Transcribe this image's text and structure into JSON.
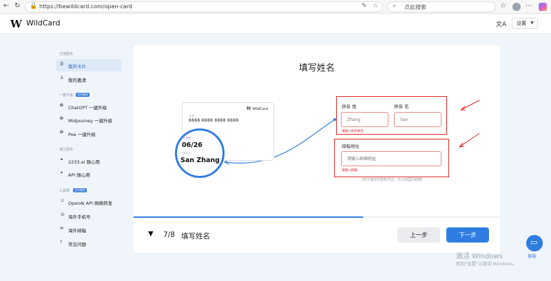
{
  "browser": {
    "url": "https://bewildcard.com/open-card",
    "search_placeholder": "点此搜索"
  },
  "header": {
    "logo_mark": "W",
    "logo_text": "WildCard",
    "settings_label": "设置"
  },
  "sidebar": {
    "sections": [
      {
        "title": "已用服务",
        "badge": ""
      },
      {
        "title": "一键升级",
        "badge": "全托服务"
      },
      {
        "title": "独立服务",
        "badge": ""
      },
      {
        "title": "工具箱",
        "badge": "全托服务"
      }
    ],
    "items": [
      {
        "label": "我的卡片",
        "icon": "cards-icon",
        "active": true
      },
      {
        "label": "我的邀请",
        "icon": "users-icon",
        "active": false
      },
      {
        "label": "ChatGPT 一键升级",
        "icon": "openai-icon",
        "active": false
      },
      {
        "label": "Midjourney 一键升级",
        "icon": "openai-icon",
        "active": false
      },
      {
        "label": "Poe 一键升级",
        "icon": "openai-icon",
        "active": false
      },
      {
        "label": "2233.ai 随心用",
        "icon": "sparkle-icon",
        "active": false
      },
      {
        "label": "API 随心用",
        "icon": "link-icon",
        "active": false
      },
      {
        "label": "OpenAI API 网络转发",
        "icon": "shuffle-icon",
        "active": false
      },
      {
        "label": "海外手机号",
        "icon": "phone-icon",
        "active": false
      },
      {
        "label": "海外邮箱",
        "icon": "mail-icon",
        "active": false
      },
      {
        "label": "常见问题",
        "icon": "help-icon",
        "active": false
      }
    ]
  },
  "main": {
    "title": "填写姓名",
    "card": {
      "brand": "WildCard",
      "number_label": "卡号",
      "number": "8888 8888 8888 8888",
      "expiry_label": "有效期",
      "expiry": "06/26",
      "name_label": "持卡人",
      "name": "San Zhang"
    },
    "form": {
      "last_name_label": "拼音 姓",
      "last_name_placeholder": "Zhang",
      "first_name_label": "拼音 名",
      "first_name_placeholder": "San",
      "name_error": "请输入姓氏拼音",
      "email_label": "邮箱地址",
      "email_placeholder": "请输入邮箱地址",
      "email_error": "请输入邮箱",
      "email_hint": "(用于接收付款账凭证，可以用国内邮箱)"
    },
    "progress": {
      "current": 7,
      "total": 8,
      "fraction": 0.625
    },
    "step_count": "7/8",
    "step_title": "填写姓名",
    "prev_label": "上一步",
    "next_label": "下一步"
  },
  "watermark": {
    "title": "激活 Windows",
    "subtitle": "转到\"设置\"以激活 Windows。"
  },
  "support": {
    "label": "客服"
  },
  "colors": {
    "accent": "#2f7de1",
    "error": "#e02424",
    "background": "#f0f5fb"
  }
}
